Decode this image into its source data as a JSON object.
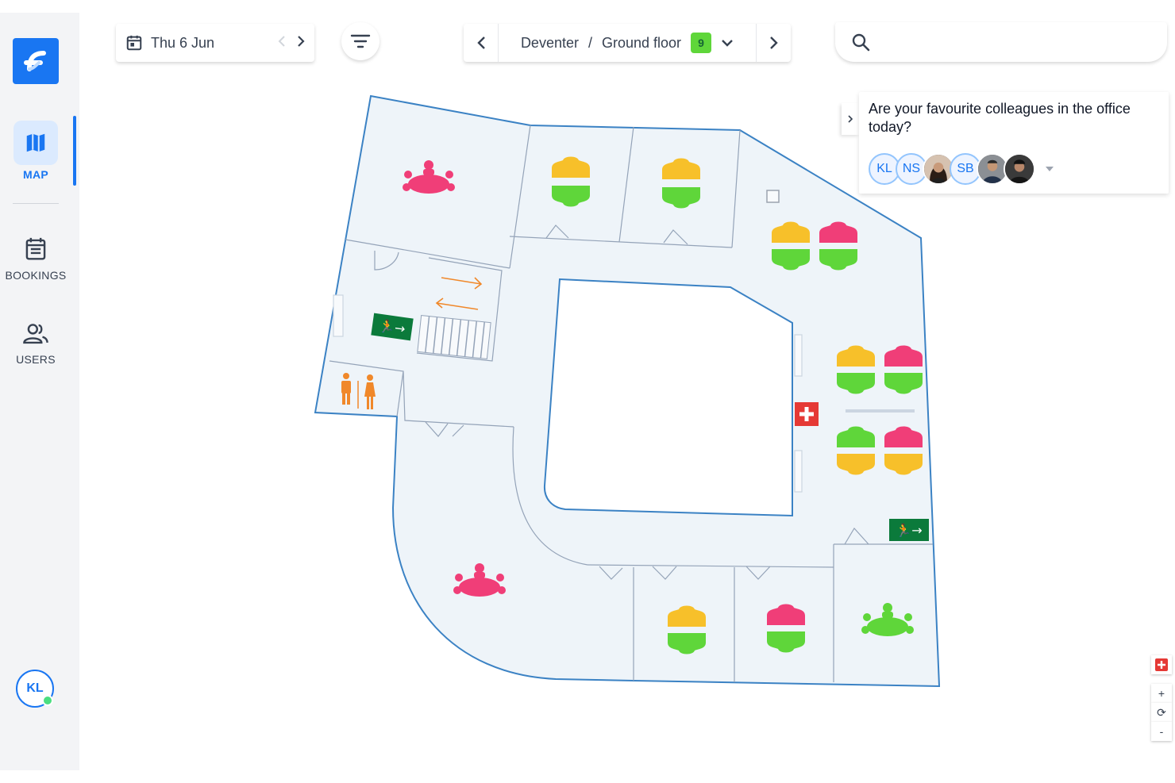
{
  "sidebar": {
    "logo_icon": "flexwhere-logo",
    "accent": "#1976f2",
    "items": [
      {
        "label": "MAP",
        "icon": "map-icon",
        "active": true
      },
      {
        "label": "BOOKINGS",
        "icon": "calendar-list-icon",
        "active": false
      },
      {
        "label": "USERS",
        "icon": "users-icon",
        "active": false
      }
    ],
    "current_user": {
      "initials": "KL",
      "status_color": "#4ade80"
    }
  },
  "toolbar": {
    "date": "Thu 6 Jun",
    "location": "Deventer",
    "separator": "/",
    "floor": "Ground floor",
    "floor_count": "9",
    "search_placeholder": ""
  },
  "colleagues_panel": {
    "question": "Are your favourite colleagues in the office today?",
    "toggle_icon": "chevron-right-icon",
    "avatars": [
      {
        "initials": "KL"
      },
      {
        "initials": "NS"
      },
      {
        "initials": "",
        "photo": true
      },
      {
        "initials": "SB"
      },
      {
        "initials": "",
        "photo": true
      },
      {
        "initials": "",
        "photo": true
      }
    ]
  },
  "floorplan": {
    "colors": {
      "available": "#5fd63a",
      "partially_booked": "#f7c02a",
      "booked": "#f03e78",
      "floor": "#eef4f9",
      "wall": "#3b82c4",
      "exit": "#0b7a3b",
      "first_aid": "#e53935",
      "restroom": "#f0882a"
    },
    "icons": [
      "meeting-room-icon",
      "desk-icon",
      "emergency-exit-icon",
      "first-aid-icon",
      "restroom-icon",
      "stairs-icon"
    ]
  },
  "map_tools": {
    "add_icon": "add-red-icon",
    "zoom_in": "+",
    "reset": "⟳",
    "zoom_out": "-"
  }
}
